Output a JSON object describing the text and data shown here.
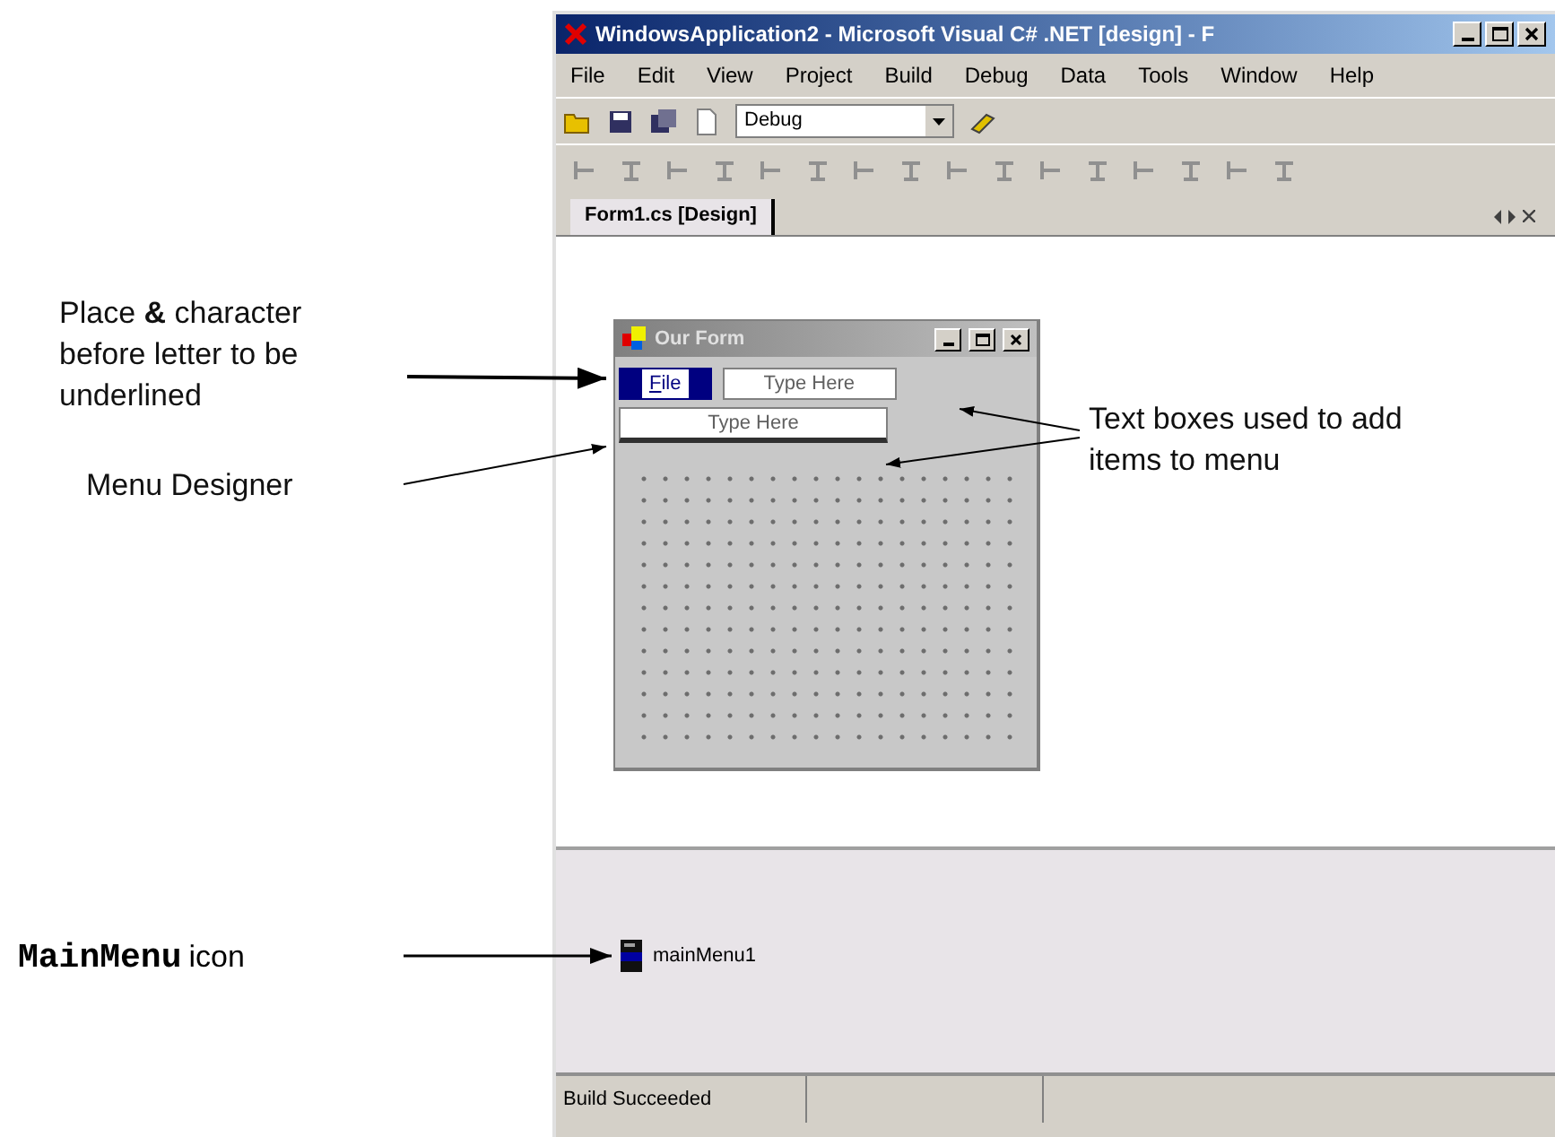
{
  "window": {
    "title": "WindowsApplication2 - Microsoft Visual C# .NET [design] - F"
  },
  "menu": [
    {
      "label": "File"
    },
    {
      "label": "Edit"
    },
    {
      "label": "View"
    },
    {
      "label": "Project"
    },
    {
      "label": "Build"
    },
    {
      "label": "Debug"
    },
    {
      "label": "Data"
    },
    {
      "label": "Tools"
    },
    {
      "label": "Window"
    },
    {
      "label": "Help"
    }
  ],
  "toolbar": {
    "configuration": "Debug"
  },
  "document_tab": {
    "label": "Form1.cs [Design]",
    "selected": true
  },
  "form": {
    "title": "Our Form",
    "menu_items": [
      {
        "label": "File",
        "mnemonic_underlined": true,
        "selected": true
      },
      {
        "label": "Type Here",
        "mnemonic_underlined": false,
        "selected": false
      }
    ],
    "submenu_items": [
      {
        "label": "Type Here",
        "selected": false
      }
    ]
  },
  "component_tray": [
    {
      "label": "mainMenu1"
    }
  ],
  "status_bar": {
    "text": "Build Succeeded"
  },
  "annotations": [
    {
      "kind": "ampersand",
      "text": "Place **&** character before letter to be underlined"
    },
    {
      "kind": "designer",
      "text": "Menu Designer"
    },
    {
      "kind": "textboxes",
      "text": "Text boxes used to add items to menu"
    },
    {
      "kind": "tray",
      "code": "MainMenu",
      "text": "icon"
    }
  ]
}
